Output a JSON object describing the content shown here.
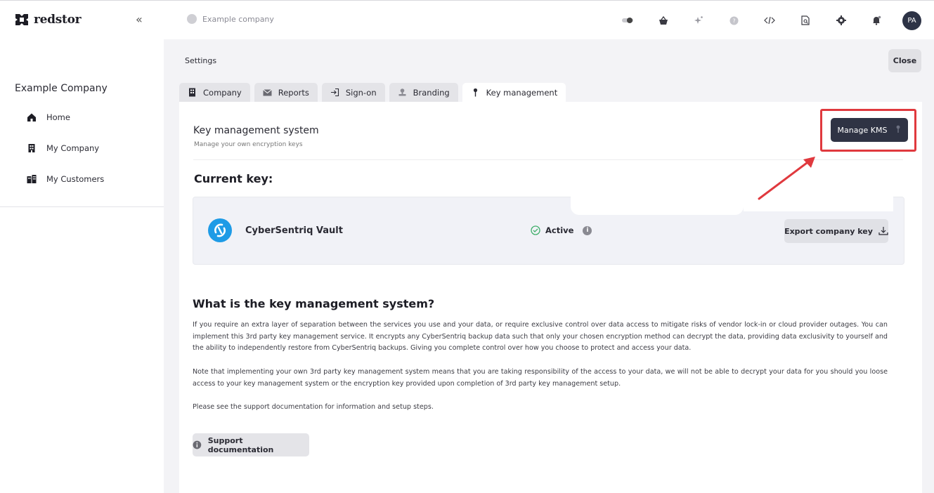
{
  "header": {
    "brand": "redstor",
    "company_selector": "Example company",
    "avatar_initials": "PA",
    "icons": [
      "toggle-icon",
      "basket-icon",
      "sparkle-icon",
      "help-icon",
      "code-icon",
      "search-doc-icon",
      "gear-icon",
      "notification-icon"
    ]
  },
  "sidebar": {
    "company": "Example Company",
    "items": [
      {
        "label": "Home",
        "icon": "home-icon"
      },
      {
        "label": "My Company",
        "icon": "building-icon"
      },
      {
        "label": "My Customers",
        "icon": "buildings-icon"
      }
    ]
  },
  "main": {
    "breadcrumb": "Settings",
    "close_label": "Close",
    "tabs": [
      {
        "label": "Company",
        "icon": "building-icon",
        "active": false
      },
      {
        "label": "Reports",
        "icon": "mail-icon",
        "active": false
      },
      {
        "label": "Sign-on",
        "icon": "sign-in-icon",
        "active": false
      },
      {
        "label": "Branding",
        "icon": "stamp-icon",
        "active": false
      },
      {
        "label": "Key management",
        "icon": "pin-icon",
        "active": true
      }
    ],
    "kms": {
      "title": "Key management system",
      "subtitle": "Manage your own encryption keys",
      "manage_button": "Manage KMS",
      "current_key_heading": "Current key:",
      "vault_name": "CyberSentriq Vault",
      "status": "Active",
      "export_button": "Export company key"
    },
    "about": {
      "heading": "What is the key management system?",
      "paragraph_1": "If you require an extra layer of separation between the services you use and your data, or require exclusive control over data access to mitigate risks of vendor lock-in or cloud provider outages. You can implement this 3rd party key management service. It encrypts any CyberSentriq backup data such that only your chosen encryption method can decrypt the data, providing data exclusivity to yourself and the ability to independently restore from CyberSentriq backups. Giving you complete control over how you choose to protect and access your data.",
      "paragraph_2": "Note that implementing your own 3rd party key management system means that you are taking responsibility of the access to your data, we will not be able to decrypt your data for you should you loose access to your key management system or the encryption key provided upon completion of 3rd party key management setup.",
      "paragraph_3": "Please see the support documentation for information and setup steps.",
      "support_button": "Support documentation"
    }
  },
  "colors": {
    "accent_dark": "#2f3344",
    "highlight": "#e0393e",
    "vault_blue": "#1e9be6",
    "active_green": "#3fae6a"
  }
}
